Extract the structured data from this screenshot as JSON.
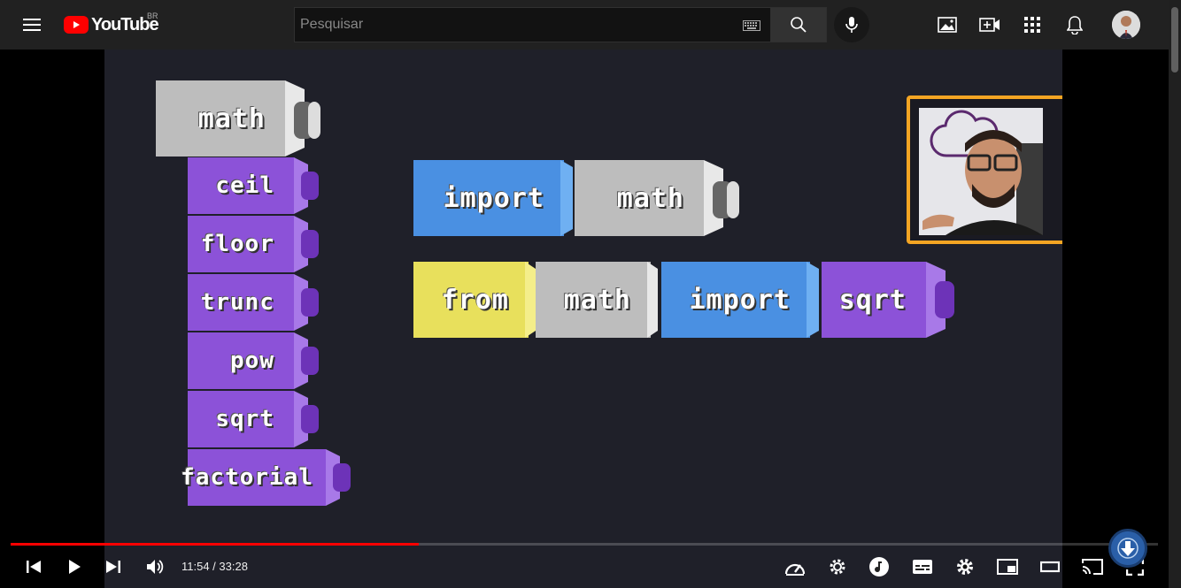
{
  "masthead": {
    "logo_text": "YouTube",
    "country_code": "BR",
    "search": {
      "placeholder": "Pesquisar",
      "value": ""
    },
    "icons": [
      "menu-icon",
      "keyboard-icon",
      "search-icon",
      "mic-icon",
      "image-icon",
      "create-video-icon",
      "apps-icon",
      "notifications-icon"
    ]
  },
  "video": {
    "stack_header": "math",
    "stack_items": [
      "ceil",
      "floor",
      "trunc",
      "pow",
      "sqrt",
      "factorial"
    ],
    "row1": [
      "import",
      "math"
    ],
    "row2": [
      "from",
      "math",
      "import",
      "sqrt"
    ]
  },
  "player": {
    "current_time": "11:54",
    "duration": "33:28",
    "time_display": "11:54 / 33:28",
    "progress": 0.356,
    "accent": "#ff0000"
  },
  "colors": {
    "masthead_bg": "#212121",
    "video_bg": "#1f2029",
    "block_purple": "#8c52d8",
    "block_gray": "#bdbdbd",
    "block_blue": "#4a90e2",
    "block_yellow": "#e8e05c",
    "webcam_border": "#f4a523"
  }
}
